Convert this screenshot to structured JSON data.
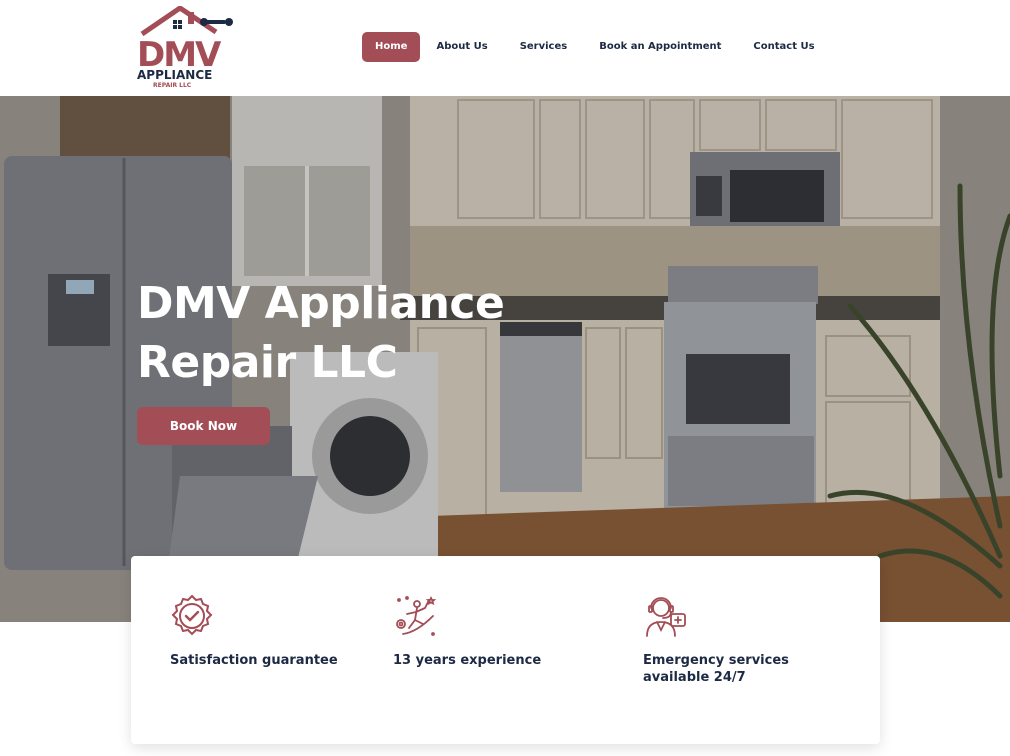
{
  "brand": {
    "logo_line1": "DMV",
    "logo_line2": "APPLIANCE",
    "logo_line3": "REPAIR LLC",
    "accent_color": "#a34d56",
    "text_color": "#1d2a44"
  },
  "nav": {
    "items": [
      {
        "label": "Home",
        "active": true
      },
      {
        "label": "About Us",
        "active": false
      },
      {
        "label": "Services",
        "active": false
      },
      {
        "label": "Book an Appointment",
        "active": false
      },
      {
        "label": "Contact Us",
        "active": false
      }
    ]
  },
  "hero": {
    "title": "DMV Appliance\nRepair LLC",
    "cta_label": "Book Now"
  },
  "features": [
    {
      "icon": "badge-check-icon",
      "label": "Satisfaction guarantee"
    },
    {
      "icon": "rocket-growth-icon",
      "label": "13 years experience"
    },
    {
      "icon": "support-agent-icon",
      "label": "Emergency services\navailable 24/7"
    }
  ]
}
